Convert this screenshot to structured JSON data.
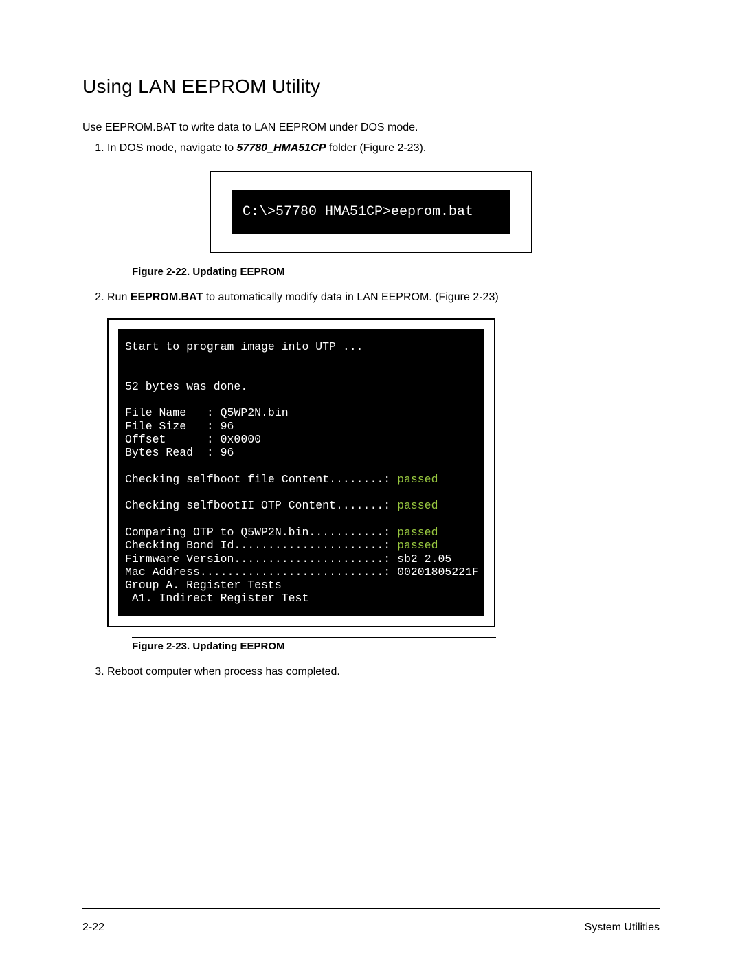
{
  "heading": "Using LAN EEPROM Utility",
  "intro": "Use EEPROM.BAT to write data to LAN EEPROM under DOS mode.",
  "steps": {
    "s1a": "In DOS mode, navigate to ",
    "s1_bi": "57780_HMA51CP",
    "s1b": " folder (Figure 2-23).",
    "s2a": "Run ",
    "s2_b": "EEPROM.BAT",
    "s2b": " to automatically modify data in LAN EEPROM. (Figure 2-23)",
    "s3": "Reboot computer when process has completed."
  },
  "figure22": {
    "cmd": "C:\\>57780_HMA51CP>eeprom.bat",
    "caption": "Figure 2-22.   Updating EEPROM"
  },
  "figure23": {
    "l1": "Start to program image into UTP ...",
    "l2": "52 bytes was done.",
    "l3": "File Name   : Q5WP2N.bin",
    "l4": "File Size   : 96",
    "l5": "Offset      : 0x0000",
    "l6": "Bytes Read  : 96",
    "l7a": "Checking selfboot file Content........: ",
    "l7b": "passed",
    "l8a": "Checking selfbootII OTP Content.......: ",
    "l8b": "passed",
    "l9a": "Comparing OTP to Q5WP2N.bin...........: ",
    "l9b": "passed",
    "l10a": "Checking Bond Id......................: ",
    "l10b": "passed",
    "l11": "Firmware Version......................: sb2 2.05",
    "l12": "Mac Address...........................: 00201805221F",
    "l13": "Group A. Register Tests",
    "l14": " A1. Indirect Register Test",
    "caption": "Figure 2-23.   Updating EEPROM"
  },
  "footer": {
    "left": "2-22",
    "right": "System Utilities"
  }
}
